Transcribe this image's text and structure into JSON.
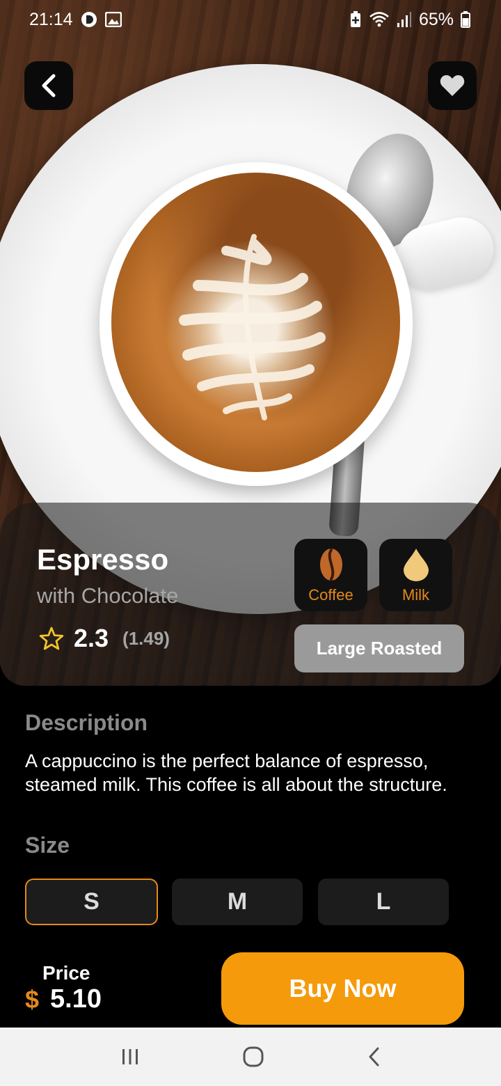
{
  "status_bar": {
    "time": "21:14",
    "battery_percent": "65%"
  },
  "product": {
    "name": "Espresso",
    "subtitle": "with Chocolate",
    "rating": "2.3",
    "rating_count": "(1.49)",
    "ingredients": [
      {
        "label": "Coffee",
        "icon": "coffee-bean-icon"
      },
      {
        "label": "Milk",
        "icon": "milk-drop-icon"
      }
    ],
    "roast": "Large Roasted"
  },
  "description": {
    "heading": "Description",
    "text": "A cappuccino is the perfect balance of espresso, steamed milk. This coffee is all about the structure."
  },
  "size": {
    "heading": "Size",
    "options": [
      "S",
      "M",
      "L"
    ],
    "selected": "S"
  },
  "price": {
    "label": "Price",
    "currency": "$",
    "value": "5.10"
  },
  "actions": {
    "buy_label": "Buy Now"
  },
  "colors": {
    "accent": "#F59A0A",
    "accent_text": "#E58A1A",
    "background": "#000000"
  }
}
